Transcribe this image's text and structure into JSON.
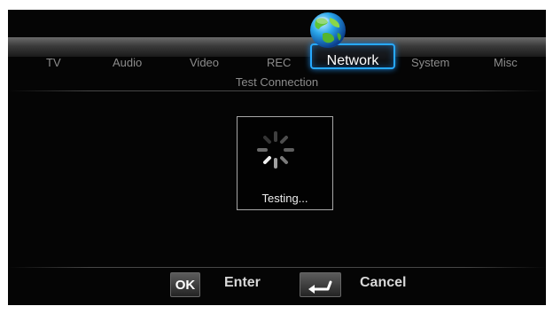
{
  "tabs": {
    "tv": "TV",
    "audio": "Audio",
    "video": "Video",
    "rec": "REC",
    "network": "Network",
    "system": "System",
    "misc": "Misc"
  },
  "page": {
    "section_title": "Test Connection",
    "status_text": "Testing..."
  },
  "footer": {
    "ok_key": "OK",
    "ok_label": "Enter",
    "cancel_label": "Cancel"
  },
  "icons": {
    "network_tab_icon": "globe-icon",
    "loading_icon": "loading-spinner-icon",
    "cancel_key_icon": "return-arrow-icon"
  },
  "colors": {
    "accent": "#27a9ff",
    "background": "#050505"
  }
}
